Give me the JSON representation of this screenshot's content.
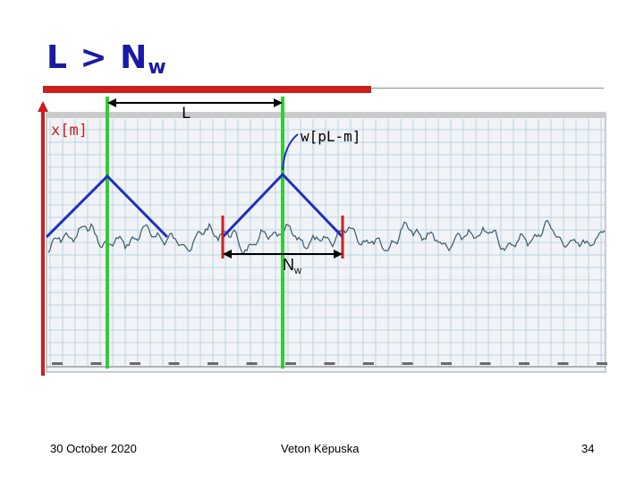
{
  "slide": {
    "title_main": "L > N",
    "title_sub": "w"
  },
  "labels": {
    "signal": "x[m]",
    "shift": "L",
    "window": "w[pL-m]",
    "window_length_main": "N",
    "window_length_sub": "w"
  },
  "colors": {
    "title": "#1a1aa6",
    "accent_red": "#cc1f1f",
    "marker_green": "#33cc33",
    "window_blue": "#1f2fbf",
    "waveform": "#3a5a6a",
    "grid": "#bcd4e6",
    "plot_background": "#f1f3f6"
  },
  "footer": {
    "date": "30 October 2020",
    "author": "Veton Këpuska",
    "page": "34"
  }
}
